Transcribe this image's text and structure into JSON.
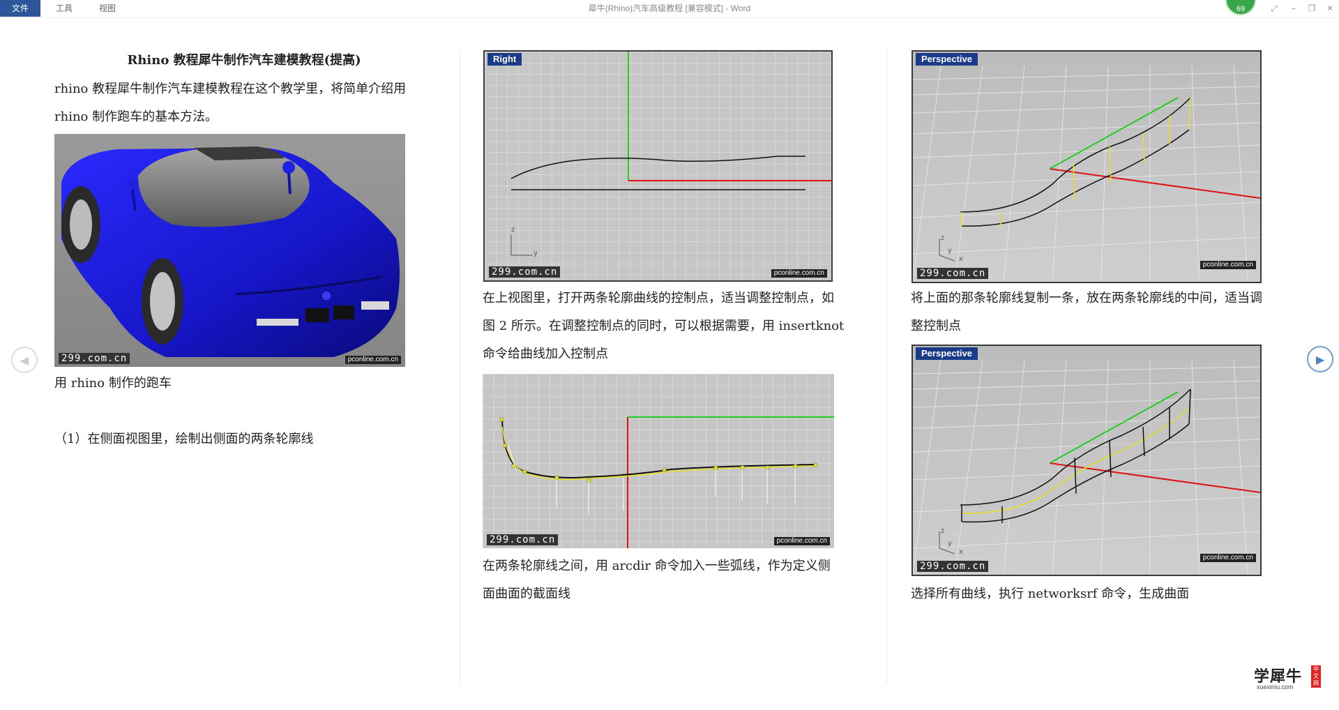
{
  "titlebar": {
    "menu": [
      "文件",
      "工具",
      "视图"
    ],
    "doc_title": "犀牛(Rhino)汽车高级教程 [兼容模式] - Word",
    "badge": "69"
  },
  "col1": {
    "heading": "Rhino 教程犀牛制作汽车建模教程(提高)",
    "intro_line1": "rhino 教程犀牛制作汽车建模教程在这个教学里，将简单介绍用",
    "intro_line2": "rhino 制作跑车的基本方法。",
    "car_caption": "用 rhino 制作的跑车",
    "step1": "（1）在侧面视图里，绘制出侧面的两条轮廓线"
  },
  "col2": {
    "vp1_label": "Right",
    "text1_line1": "在上视图里，打开两条轮廓曲线的控制点，适当调整控制点，如",
    "text1_line2": "图 2 所示。在调整控制点的同时，可以根据需要，用 insertknot",
    "text1_line3": "命令给曲线加入控制点",
    "text2_line1": "在两条轮廓线之间，用 arcdir 命令加入一些弧线，作为定义侧",
    "text2_line2": "面曲面的截面线"
  },
  "col3": {
    "vp1_label": "Perspective",
    "text1_line1": "将上面的那条轮廓线复制一条，放在两条轮廓线的中间，适当调",
    "text1_line2": "整控制点",
    "vp2_label": "Perspective",
    "text2_line1": "选择所有曲线，执行 networksrf 命令，生成曲面"
  },
  "watermarks": {
    "site299": "299.com.cn",
    "pconline": "pconline.com.cn"
  },
  "axis_labels": {
    "z": "z",
    "y": "y",
    "x": "x"
  },
  "logo": {
    "main": "学犀牛",
    "sub": "xuexiniu.com",
    "tag": "中文网"
  },
  "colors": {
    "accent": "#2b579a",
    "car_blue": "#1a1ad0",
    "axis_green": "#22cc22",
    "axis_red": "#dd1111",
    "curve_yellow": "#e8e020"
  }
}
